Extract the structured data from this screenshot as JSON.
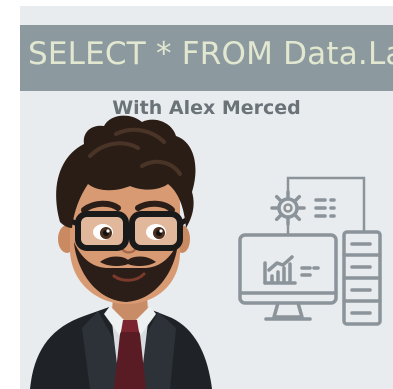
{
  "cover": {
    "title": "SELECT * FROM Data.Lake",
    "subtitle": "With Alex Merced"
  },
  "illustration": {
    "subject": "cartoon-avatar",
    "icons": [
      "gear-icon",
      "list-icon",
      "monitor-chart-icon",
      "server-rack-icon"
    ]
  },
  "colors": {
    "background": "#e9ecee",
    "title_bar": "#8c9aa0",
    "title_text": "#e2e7cf",
    "subtitle_text": "#6a7378",
    "icon_stroke": "#8b949a"
  }
}
